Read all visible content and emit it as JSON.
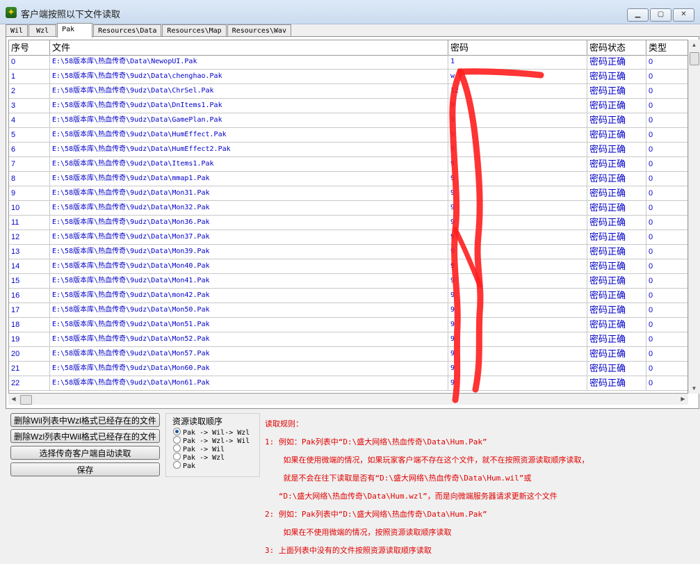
{
  "window": {
    "title": "客户端按照以下文件读取",
    "icon": "game-icon"
  },
  "tabs": [
    {
      "label": "Wil",
      "active": false
    },
    {
      "label": "Wzl",
      "active": false
    },
    {
      "label": "Pak",
      "active": true
    },
    {
      "label": "Resources\\Data",
      "active": false
    },
    {
      "label": "Resources\\Map",
      "active": false
    },
    {
      "label": "Resources\\Wav",
      "active": false
    }
  ],
  "table": {
    "columns": [
      "序号",
      "文件",
      "密码",
      "密码状态",
      "类型"
    ],
    "rows": [
      [
        "0",
        "E:\\58版本库\\热血传奇\\Data\\NewopUI.Pak",
        "1",
        "密码正确",
        "0"
      ],
      [
        "1",
        "E:\\58版本库\\热血传奇\\9udz\\Data\\chenghao.Pak",
        "w",
        "密码正确",
        "0"
      ],
      [
        "2",
        "E:\\58版本库\\热血传奇\\9udz\\Data\\ChrSel.Pak",
        "12",
        "密码正确",
        "0"
      ],
      [
        "3",
        "E:\\58版本库\\热血传奇\\9udz\\Data\\DnItems1.Pak",
        "9",
        "密码正确",
        "0"
      ],
      [
        "4",
        "E:\\58版本库\\热血传奇\\9udz\\Data\\GamePlan.Pak",
        "9",
        "密码正确",
        "0"
      ],
      [
        "5",
        "E:\\58版本库\\热血传奇\\9udz\\Data\\HumEffect.Pak",
        "9",
        "密码正确",
        "0"
      ],
      [
        "6",
        "E:\\58版本库\\热血传奇\\9udz\\Data\\HumEffect2.Pak",
        "9",
        "密码正确",
        "0"
      ],
      [
        "7",
        "E:\\58版本库\\热血传奇\\9udz\\Data\\Items1.Pak",
        "9",
        "密码正确",
        "0"
      ],
      [
        "8",
        "E:\\58版本库\\热血传奇\\9udz\\Data\\mmap1.Pak",
        "9",
        "密码正确",
        "0"
      ],
      [
        "9",
        "E:\\58版本库\\热血传奇\\9udz\\Data\\Mon31.Pak",
        "9",
        "密码正确",
        "0"
      ],
      [
        "10",
        "E:\\58版本库\\热血传奇\\9udz\\Data\\Mon32.Pak",
        "9",
        "密码正确",
        "0"
      ],
      [
        "11",
        "E:\\58版本库\\热血传奇\\9udz\\Data\\Mon36.Pak",
        "9",
        "密码正确",
        "0"
      ],
      [
        "12",
        "E:\\58版本库\\热血传奇\\9udz\\Data\\Mon37.Pak",
        "9",
        "密码正确",
        "0"
      ],
      [
        "13",
        "E:\\58版本库\\热血传奇\\9udz\\Data\\Mon39.Pak",
        "9",
        "密码正确",
        "0"
      ],
      [
        "14",
        "E:\\58版本库\\热血传奇\\9udz\\Data\\Mon40.Pak",
        "9",
        "密码正确",
        "0"
      ],
      [
        "15",
        "E:\\58版本库\\热血传奇\\9udz\\Data\\Mon41.Pak",
        "9",
        "密码正确",
        "0"
      ],
      [
        "16",
        "E:\\58版本库\\热血传奇\\9udz\\Data\\mon42.Pak",
        "9",
        "密码正确",
        "0"
      ],
      [
        "17",
        "E:\\58版本库\\热血传奇\\9udz\\Data\\Mon50.Pak",
        "9",
        "密码正确",
        "0"
      ],
      [
        "18",
        "E:\\58版本库\\热血传奇\\9udz\\Data\\Mon51.Pak",
        "9",
        "密码正确",
        "0"
      ],
      [
        "19",
        "E:\\58版本库\\热血传奇\\9udz\\Data\\Mon52.Pak",
        "9",
        "密码正确",
        "0"
      ],
      [
        "20",
        "E:\\58版本库\\热血传奇\\9udz\\Data\\Mon57.Pak",
        "9",
        "密码正确",
        "0"
      ],
      [
        "21",
        "E:\\58版本库\\热血传奇\\9udz\\Data\\Mon60.Pak",
        "9",
        "密码正确",
        "0"
      ],
      [
        "22",
        "E:\\58版本库\\热血传奇\\9udz\\Data\\Mon61.Pak",
        "9",
        "密码正确",
        "0"
      ]
    ]
  },
  "buttons": [
    "删除Wil列表中Wzl格式已经存在的文件",
    "删除Wzl列表中Wil格式已经存在的文件",
    "选择传奇客户端自动读取",
    "保存"
  ],
  "read_order": {
    "title": "资源读取顺序",
    "options": [
      {
        "label": "Pak -> Wil-> Wzl",
        "selected": true
      },
      {
        "label": "Pak -> Wzl-> Wil",
        "selected": false
      },
      {
        "label": "Pak -> Wil",
        "selected": false
      },
      {
        "label": "Pak -> Wzl",
        "selected": false
      },
      {
        "label": "Pak",
        "selected": false
      }
    ]
  },
  "rules": {
    "lines": [
      "读取规则：",
      "1: 例如：Pak列表中“D:\\盛大网络\\热血传奇\\Data\\Hum.Pak”",
      "    如果在使用微端的情况，如果玩家客户端不存在这个文件，就不在按照资源读取顺序读取，",
      "    就是不会在往下读取是否有“D:\\盛大网络\\热血传奇\\Data\\Hum.wil”或",
      "   “D:\\盛大网络\\热血传奇\\Data\\Hum.wzl”，而是向微端服务器请求更新这个文件",
      "2: 例如：Pak列表中“D:\\盛大网络\\热血传奇\\Data\\Hum.Pak”",
      "    如果在不使用微端的情况，按照资源读取顺序读取",
      "3: 上面列表中没有的文件按照资源读取顺序读取"
    ]
  },
  "colors": {
    "link_blue": "#0000c8",
    "rule_red": "#e00000",
    "scribble_red": "#ff1e1e"
  }
}
